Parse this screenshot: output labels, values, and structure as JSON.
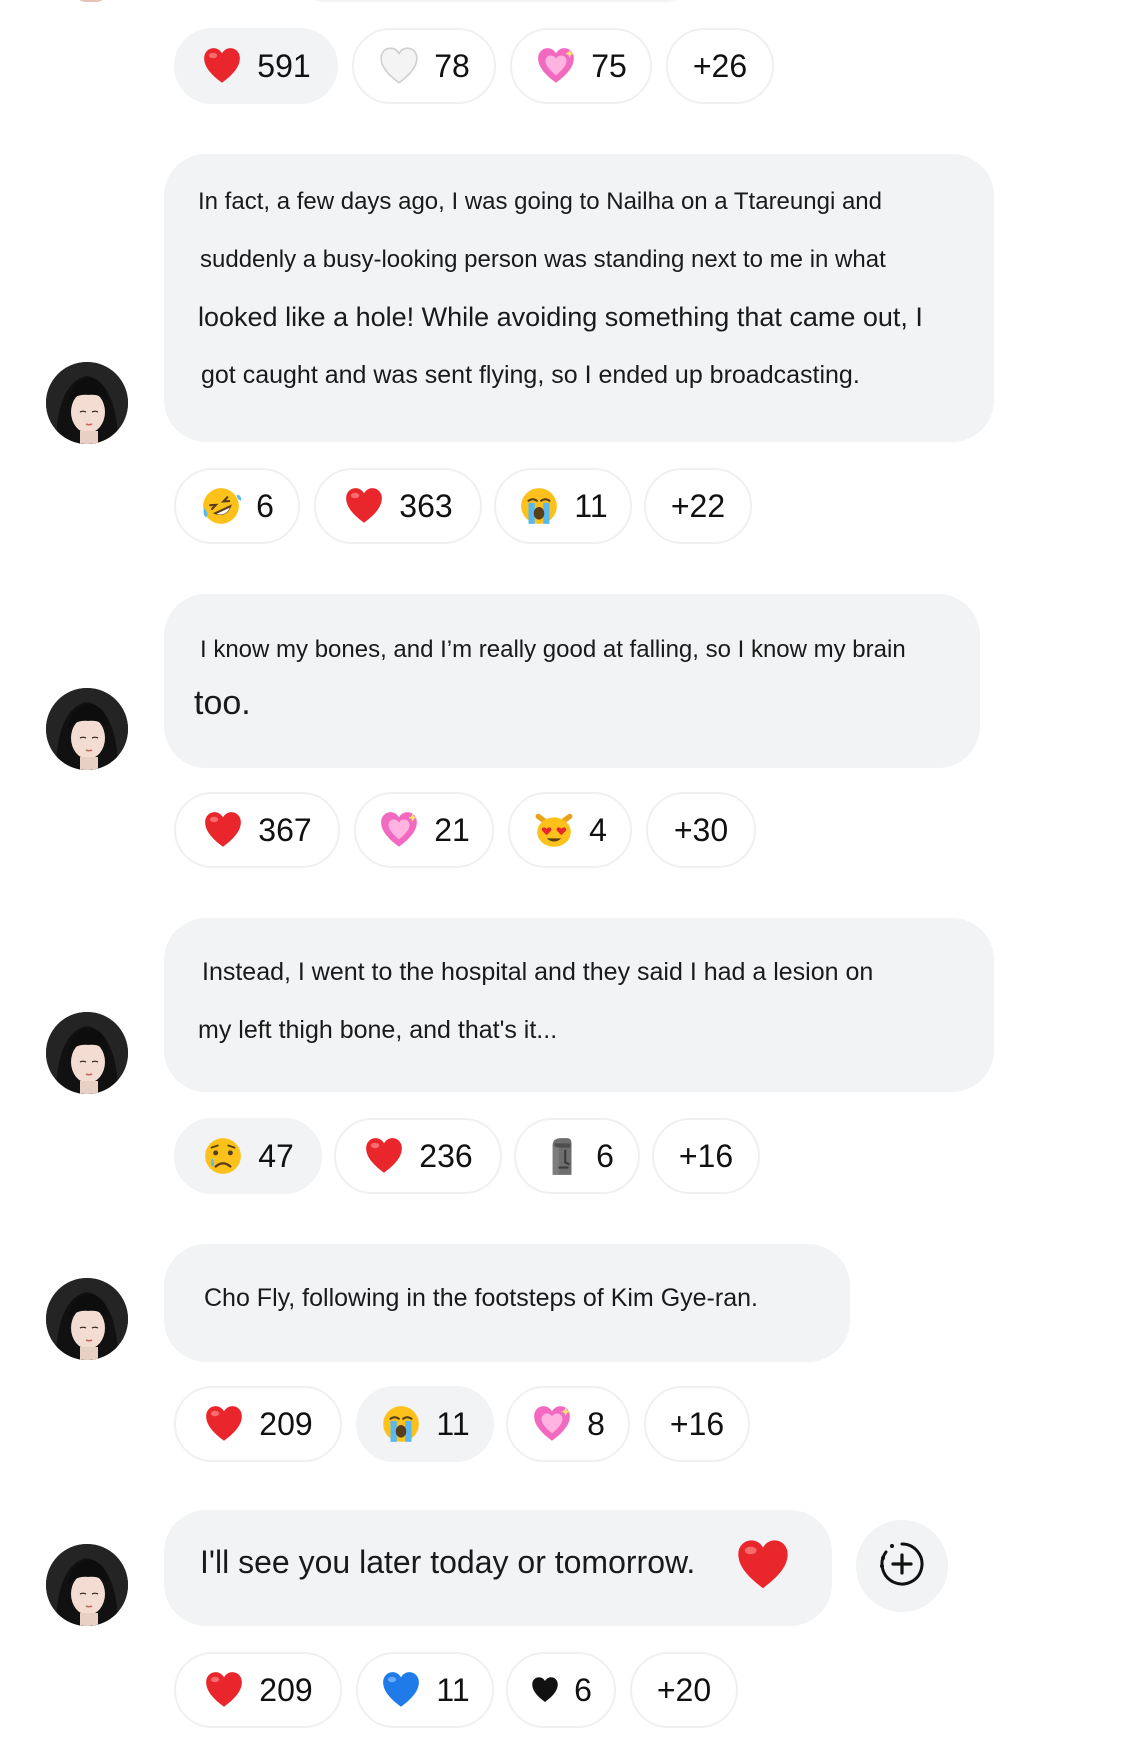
{
  "messages": [
    {
      "lines": [],
      "reactions": [
        {
          "icon": "red-heart",
          "count": "591",
          "active": true
        },
        {
          "icon": "white-heart",
          "count": "78"
        },
        {
          "icon": "sparkling-heart",
          "count": "75"
        },
        {
          "icon": "",
          "count": "+26"
        }
      ]
    },
    {
      "lines": [
        "In fact, a few days ago, I was going to Nailha on a Ttareungi and",
        "suddenly a busy-looking person was standing next to me in what",
        "looked like a hole! While avoiding something that came out, I",
        "got caught and was sent flying, so I ended up broadcasting."
      ],
      "reactions": [
        {
          "icon": "rolling-laughing-face",
          "count": "6"
        },
        {
          "icon": "red-heart",
          "count": "363"
        },
        {
          "icon": "loudly-crying-face",
          "count": "11"
        },
        {
          "icon": "",
          "count": "+22"
        }
      ]
    },
    {
      "lines": [
        "I know my bones, and I’m really good at falling, so I know my brain",
        "too."
      ],
      "reactions": [
        {
          "icon": "red-heart",
          "count": "367"
        },
        {
          "icon": "sparkling-heart",
          "count": "21"
        },
        {
          "icon": "heart-eyes-cat",
          "count": "4"
        },
        {
          "icon": "",
          "count": "+30"
        }
      ]
    },
    {
      "lines": [
        "Instead, I went to the hospital and they said I had a lesion on",
        "my left thigh bone, and that's it..."
      ],
      "reactions": [
        {
          "icon": "crying-face",
          "count": "47",
          "active": true
        },
        {
          "icon": "red-heart",
          "count": "236"
        },
        {
          "icon": "moai",
          "count": "6"
        },
        {
          "icon": "",
          "count": "+16"
        }
      ]
    },
    {
      "lines": [
        "Cho Fly, following in the footsteps of Kim Gye-ran."
      ],
      "reactions": [
        {
          "icon": "red-heart",
          "count": "209"
        },
        {
          "icon": "loudly-crying-face",
          "count": "11",
          "active": true
        },
        {
          "icon": "sparkling-heart",
          "count": "8"
        },
        {
          "icon": "",
          "count": "+16"
        }
      ]
    },
    {
      "lines": [
        "I'll see you later today or tomorrow."
      ],
      "trailing_icon": "red-heart",
      "reactions": [
        {
          "icon": "red-heart",
          "count": "209"
        },
        {
          "icon": "blue-heart",
          "count": "11"
        },
        {
          "icon": "black-heart",
          "count": "6"
        },
        {
          "icon": "",
          "count": "+20"
        }
      ]
    }
  ],
  "add_reaction_icon": "add-reaction-icon",
  "colors": {
    "bubble_bg": "#f1f3f4",
    "pill_border": "#eef0f2",
    "heart_red": "#e8262c",
    "heart_blue": "#1e7be8"
  }
}
